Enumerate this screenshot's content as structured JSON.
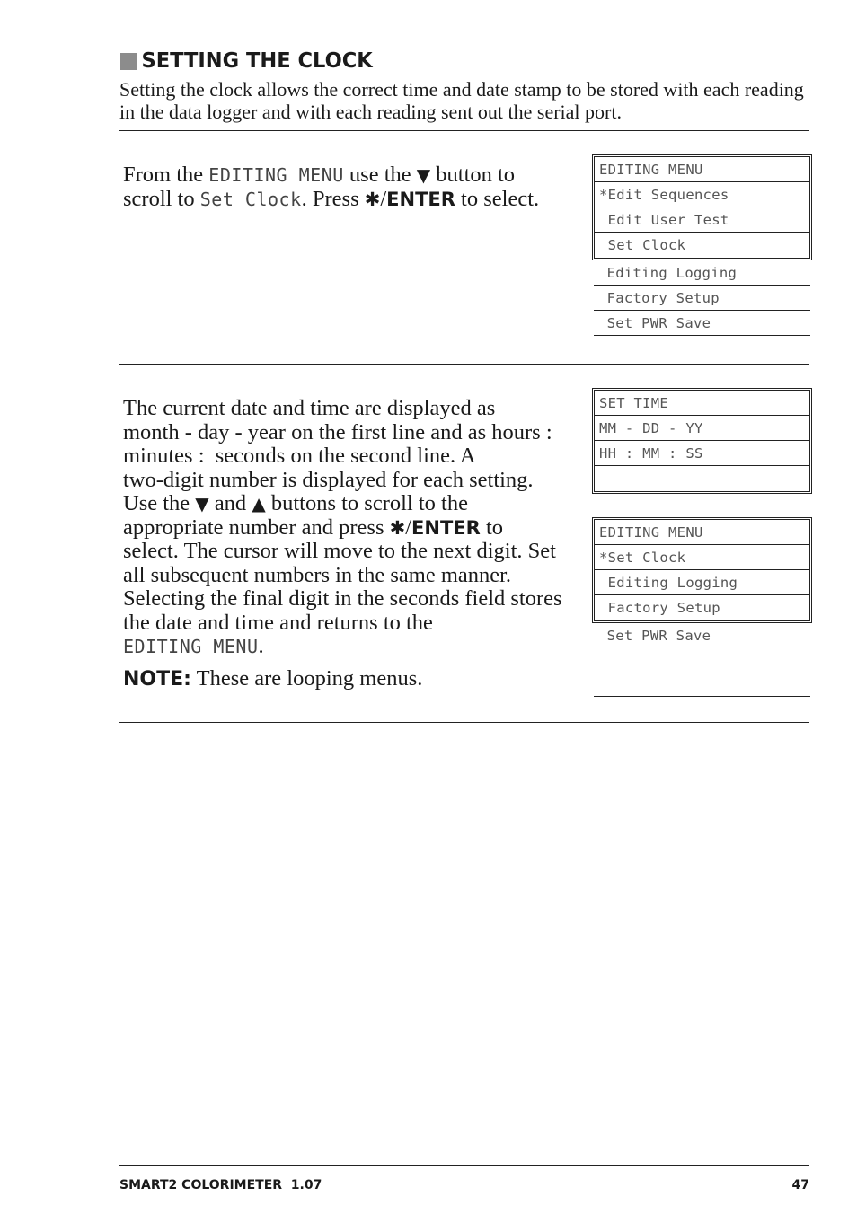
{
  "heading": "SETTING THE CLOCK",
  "intro": "Setting the clock allows the correct time and date stamp to be stored with each reading in the data logger and with each reading sent out the serial port.",
  "step1": {
    "t1": "From the ",
    "lcd1": "EDITING MENU",
    "t2": " use the ",
    "down_arrow": "▼",
    "t3": " button to",
    "t4": "scroll to ",
    "lcd2": "Set Clock",
    "t5": ". Press ",
    "star": "✱",
    "slash": "/",
    "enter": "ENTER",
    "t6": " to select."
  },
  "panel1": {
    "boxed_rows": [
      "EDITING MENU",
      "*Edit Sequences",
      " Edit User Test",
      " Set Clock"
    ],
    "loose_rows": [
      " Editing Logging",
      " Factory Setup",
      " Set PWR Save"
    ]
  },
  "step2": {
    "lines": [
      "The current date and time are displayed as",
      "month - day - year on the first line and as hours :",
      "minutes :  seconds on the second line. A",
      "two-digit number is displayed for each setting."
    ],
    "use_the": "Use the ",
    "down_arrow": "▼",
    "and": " and ",
    "up_arrow": "▲",
    "scroll_text": " buttons to scroll to the",
    "press_text": "appropriate number and press ",
    "star": "✱",
    "slash": "/",
    "enter": "ENTER",
    "to": " to",
    "lines2": [
      "select. The cursor will move to the next digit. Set",
      "all subsequent numbers in the same manner.",
      "Selecting the final digit in the seconds field stores",
      "the date and time and returns to the"
    ],
    "lcd_end": "EDITING MENU",
    "period": ".",
    "note_label": "NOTE:",
    "note_text": " These are looping menus."
  },
  "panel2": {
    "boxed_rows": [
      "SET TIME",
      "MM - DD - YY",
      "HH : MM : SS",
      ""
    ]
  },
  "panel3": {
    "boxed_rows": [
      "EDITING MENU",
      "*Set Clock",
      " Editing Logging",
      " Factory Setup"
    ],
    "loose_rows": [
      " Set PWR Save"
    ]
  },
  "footer": {
    "title": "SMART2 COLORIMETER  1.07",
    "page_number": "47"
  }
}
